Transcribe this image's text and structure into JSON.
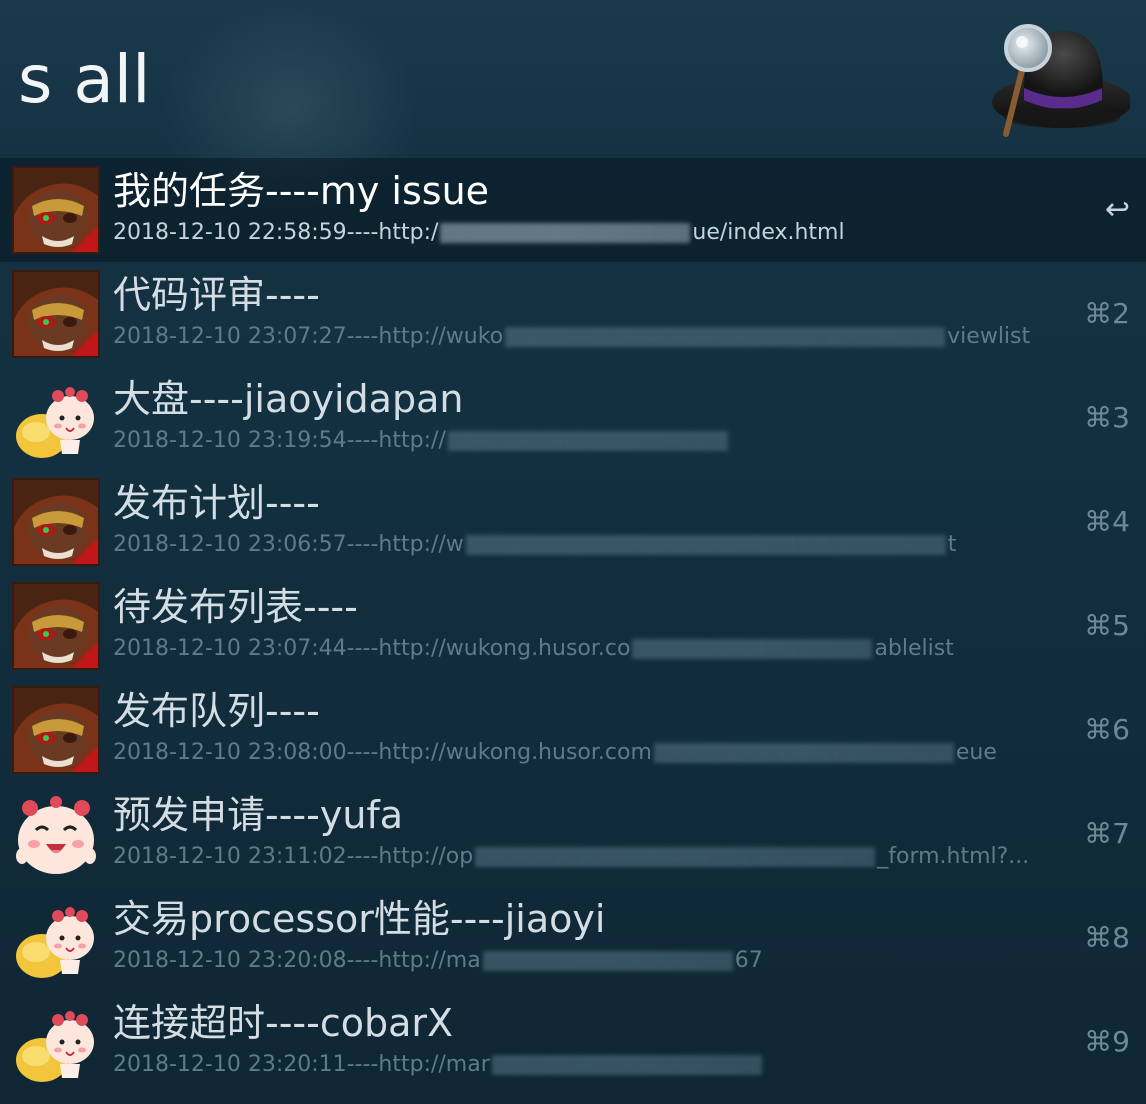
{
  "search": {
    "query": "s all"
  },
  "results": [
    {
      "title": "我的任务----my issue",
      "subtitle_prefix": "2018-12-10 22:58:59----http:/",
      "subtitle_suffix": "ue/index.html",
      "shortcut": "↩",
      "icon": "monkey-king-avatar-icon",
      "selected": true
    },
    {
      "title": "代码评审----",
      "subtitle_prefix": "2018-12-10 23:07:27----http://wuko",
      "subtitle_suffix": "viewlist",
      "shortcut": "⌘2",
      "icon": "monkey-king-avatar-icon"
    },
    {
      "title": "大盘----jiaoyidapan",
      "subtitle_prefix": "2018-12-10 23:19:54----http://",
      "subtitle_suffix": "",
      "shortcut": "⌘3",
      "icon": "mascot-with-bag-icon"
    },
    {
      "title": "发布计划----",
      "subtitle_prefix": "2018-12-10 23:06:57----http://w",
      "subtitle_suffix": "t",
      "shortcut": "⌘4",
      "icon": "monkey-king-avatar-icon"
    },
    {
      "title": "待发布列表----",
      "subtitle_prefix": "2018-12-10 23:07:44----http://wukong.husor.co",
      "subtitle_suffix": "ablelist",
      "shortcut": "⌘5",
      "icon": "monkey-king-avatar-icon"
    },
    {
      "title": "发布队列----",
      "subtitle_prefix": "2018-12-10 23:08:00----http://wukong.husor.com",
      "subtitle_suffix": "eue",
      "shortcut": "⌘6",
      "icon": "monkey-king-avatar-icon"
    },
    {
      "title": "预发申请----yufa",
      "subtitle_prefix": "2018-12-10 23:11:02----http://op",
      "subtitle_suffix": "_form.html?...",
      "shortcut": "⌘7",
      "icon": "mascot-face-icon"
    },
    {
      "title": "交易processor性能----jiaoyi",
      "subtitle_prefix": "2018-12-10 23:20:08----http://ma",
      "subtitle_suffix": "67",
      "shortcut": "⌘8",
      "icon": "mascot-with-bag-icon"
    },
    {
      "title": "连接超时----cobarX",
      "subtitle_prefix": "2018-12-10 23:20:11----http://mar",
      "subtitle_suffix": "",
      "shortcut": "⌘9",
      "icon": "mascot-with-bag-icon"
    }
  ],
  "colors": {
    "background": "#12303f",
    "selected_row": "#0b1d28",
    "title_text": "#d3dde3",
    "subtitle_text": "#5f7b8a"
  }
}
